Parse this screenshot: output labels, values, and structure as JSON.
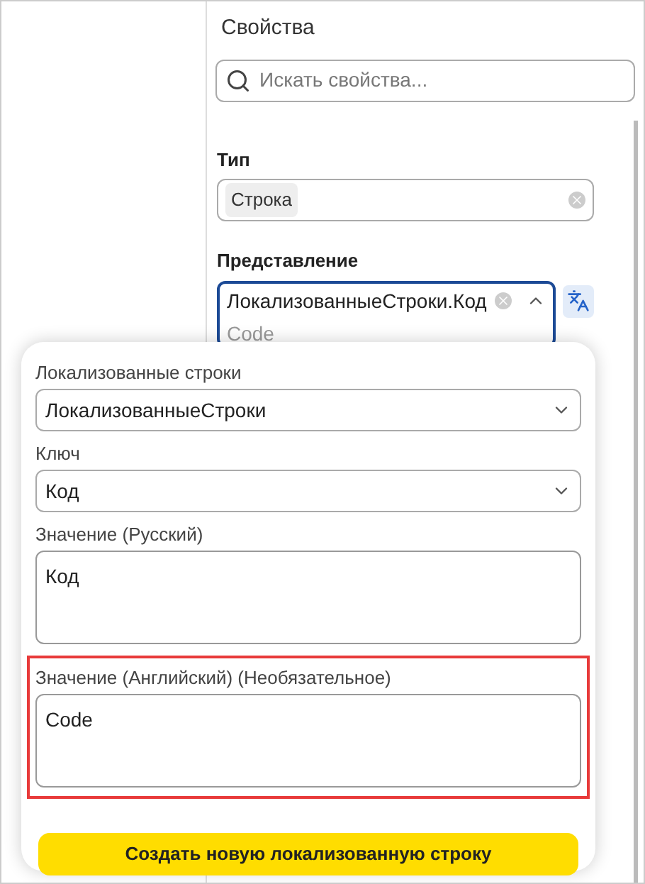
{
  "panel": {
    "title": "Свойства",
    "search": {
      "placeholder": "Искать свойства..."
    },
    "type_field": {
      "label": "Тип",
      "chip": "Строка"
    },
    "presentation_field": {
      "label": "Представление",
      "value": "ЛокализованныеСтроки.Код",
      "hint": "Code",
      "expanded": true
    }
  },
  "popup": {
    "fields": [
      {
        "kind": "select",
        "label": "Локализованные строки",
        "value": "ЛокализованныеСтроки",
        "highlighted": false
      },
      {
        "kind": "select",
        "label": "Ключ",
        "value": "Код",
        "highlighted": false
      },
      {
        "kind": "textarea",
        "label": "Значение (Русский)",
        "value": "Код",
        "highlighted": false
      },
      {
        "kind": "textarea",
        "label": "Значение (Английский) (Необязательное)",
        "value": "Code",
        "highlighted": true
      }
    ],
    "button": "Создать новую локализованную строку"
  }
}
